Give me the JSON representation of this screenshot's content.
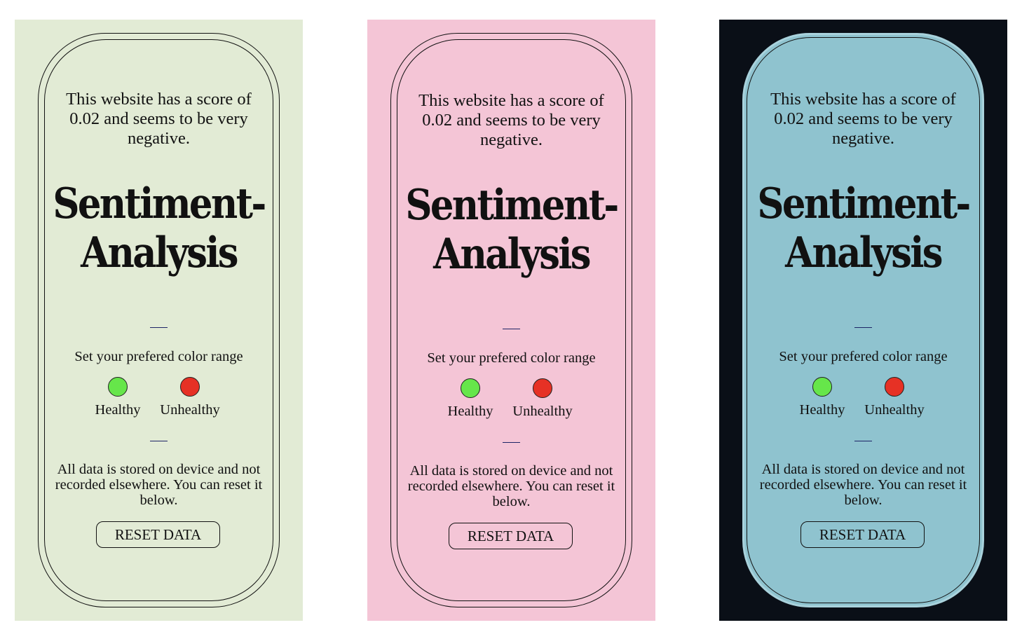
{
  "colors": {
    "green_panel_bg": "#e2ebd5",
    "pink_panel_bg": "#f4c5d6",
    "dark_panel_bg": "#0a0f17",
    "dark_card_bg": "#8fc3cf",
    "healthy_swatch": "#66e64a",
    "unhealthy_swatch": "#e63125"
  },
  "panels": [
    {
      "theme": "light-green",
      "intro_text": "This website has a score of 0.02 and seems to be very negative.",
      "title_line1": "Sentiment-",
      "title_line2": "Analysis",
      "range_label": "Set your prefered color range",
      "healthy_label": "Healthy",
      "unhealthy_label": "Unhealthy",
      "storage_note": "All data is stored on device and not recorded elsewhere. You can reset it below.",
      "reset_button": "RESET DATA"
    },
    {
      "theme": "pink",
      "intro_text": "This website has a score of 0.02 and seems to be very negative.",
      "title_line1": "Sentiment-",
      "title_line2": "Analysis",
      "range_label": "Set your prefered color range",
      "healthy_label": "Healthy",
      "unhealthy_label": "Unhealthy",
      "storage_note": "All data is stored on device and not recorded elsewhere. You can reset it below.",
      "reset_button": "RESET DATA"
    },
    {
      "theme": "dark-blue",
      "intro_text": "This website has a score of 0.02 and seems to be very negative.",
      "title_line1": "Sentiment-",
      "title_line2": "Analysis",
      "range_label": "Set your prefered color range",
      "healthy_label": "Healthy",
      "unhealthy_label": "Unhealthy",
      "storage_note": "All data is stored on device and not recorded elsewhere. You can reset it below.",
      "reset_button": "RESET DATA"
    }
  ]
}
